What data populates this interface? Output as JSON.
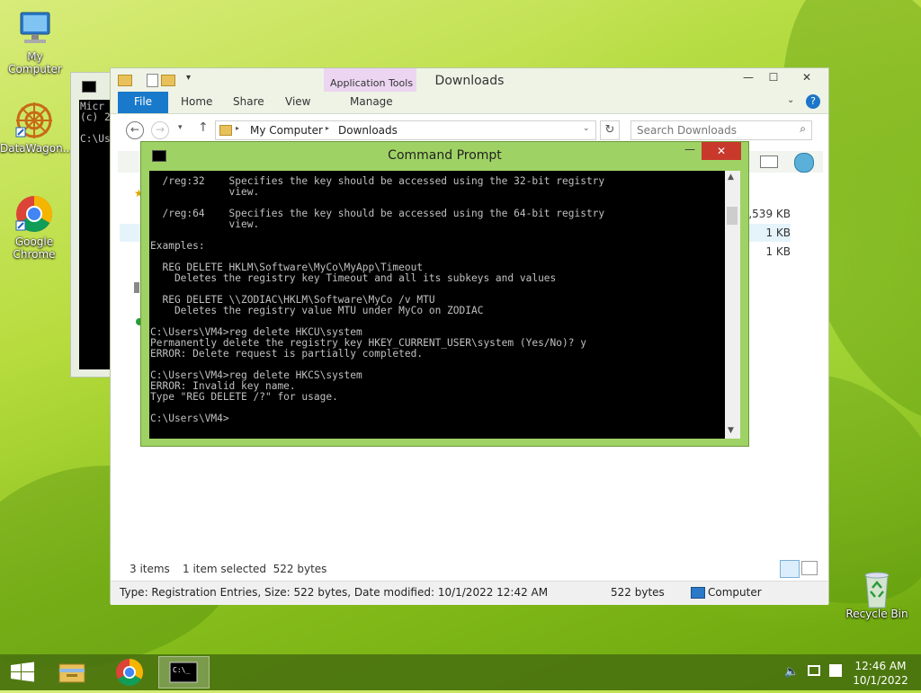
{
  "desktop": {
    "icons": [
      {
        "label": "My Computer",
        "icon": "computer-icon"
      },
      {
        "label": "DataWagon...",
        "icon": "datawagon-icon"
      },
      {
        "label": "Google Chrome",
        "icon": "chrome-icon"
      },
      {
        "label": "Recycle Bin",
        "icon": "recycle-bin-icon"
      }
    ]
  },
  "cmd_background": {
    "lines": [
      "Micr",
      "(c) 2",
      "",
      "C:\\Us"
    ]
  },
  "explorer": {
    "title": "Downloads",
    "context_tab_group": "Application Tools",
    "tabs": {
      "file": "File",
      "home": "Home",
      "share": "Share",
      "view": "View",
      "manage": "Manage"
    },
    "breadcrumb": {
      "root": "My Computer",
      "folder": "Downloads"
    },
    "search_placeholder": "Search Downloads",
    "sizes": [
      "1,539 KB",
      "1 KB",
      "1 KB"
    ],
    "status": {
      "items": "3 items",
      "selected": "1 item selected  522 bytes"
    },
    "details": {
      "text": "Type: Registration Entries, Size: 522 bytes, Date modified: 10/1/2022 12:42 AM",
      "size": "522 bytes",
      "location": "Computer"
    }
  },
  "cmd": {
    "title": "Command Prompt",
    "lines": [
      "  /reg:32    Specifies the key should be accessed using the 32-bit registry",
      "             view.",
      "",
      "  /reg:64    Specifies the key should be accessed using the 64-bit registry",
      "             view.",
      "",
      "Examples:",
      "",
      "  REG DELETE HKLM\\Software\\MyCo\\MyApp\\Timeout",
      "    Deletes the registry key Timeout and all its subkeys and values",
      "",
      "  REG DELETE \\\\ZODIAC\\HKLM\\Software\\MyCo /v MTU",
      "    Deletes the registry value MTU under MyCo on ZODIAC",
      "",
      "C:\\Users\\VM4>reg delete HKCU\\system",
      "Permanently delete the registry key HKEY_CURRENT_USER\\system (Yes/No)? y",
      "ERROR: Delete request is partially completed.",
      "",
      "C:\\Users\\VM4>reg delete HKCS\\system",
      "ERROR: Invalid key name.",
      "Type \"REG DELETE /?\" for usage.",
      "",
      "C:\\Users\\VM4>"
    ]
  },
  "taskbar": {
    "items": [
      {
        "icon": "start-icon"
      },
      {
        "icon": "file-explorer-icon"
      },
      {
        "icon": "chrome-icon"
      },
      {
        "icon": "command-prompt-icon"
      }
    ],
    "clock": {
      "time": "12:46 AM",
      "date": "10/1/2022"
    }
  }
}
